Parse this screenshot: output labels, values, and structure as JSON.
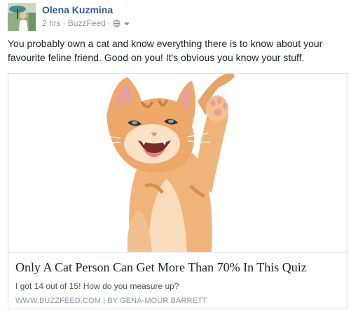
{
  "post": {
    "author": "Olena Kuzmina",
    "time": "2 hrs",
    "separator": "·",
    "source": "BuzzFeed",
    "privacy_icon": "globe-icon",
    "menu_icon": "chevron-down-icon",
    "text": "You probably own a cat and know everything there is to know about your favourite feline friend. Good on you! It's obvious you know your stuff."
  },
  "card": {
    "image_subject": "kitten-photo",
    "title": "Only A Cat Person Can Get More Than 70% In This Quiz",
    "description": "I got 14 out of 15! How do you measure up?",
    "source_line": "WWW.BUZZFEED.COM | BY GENA-MOUR BARRETT"
  },
  "colors": {
    "author_link": "#365899",
    "meta_gray": "#90949c",
    "text": "#1d2129",
    "border": "#dddfe2"
  }
}
